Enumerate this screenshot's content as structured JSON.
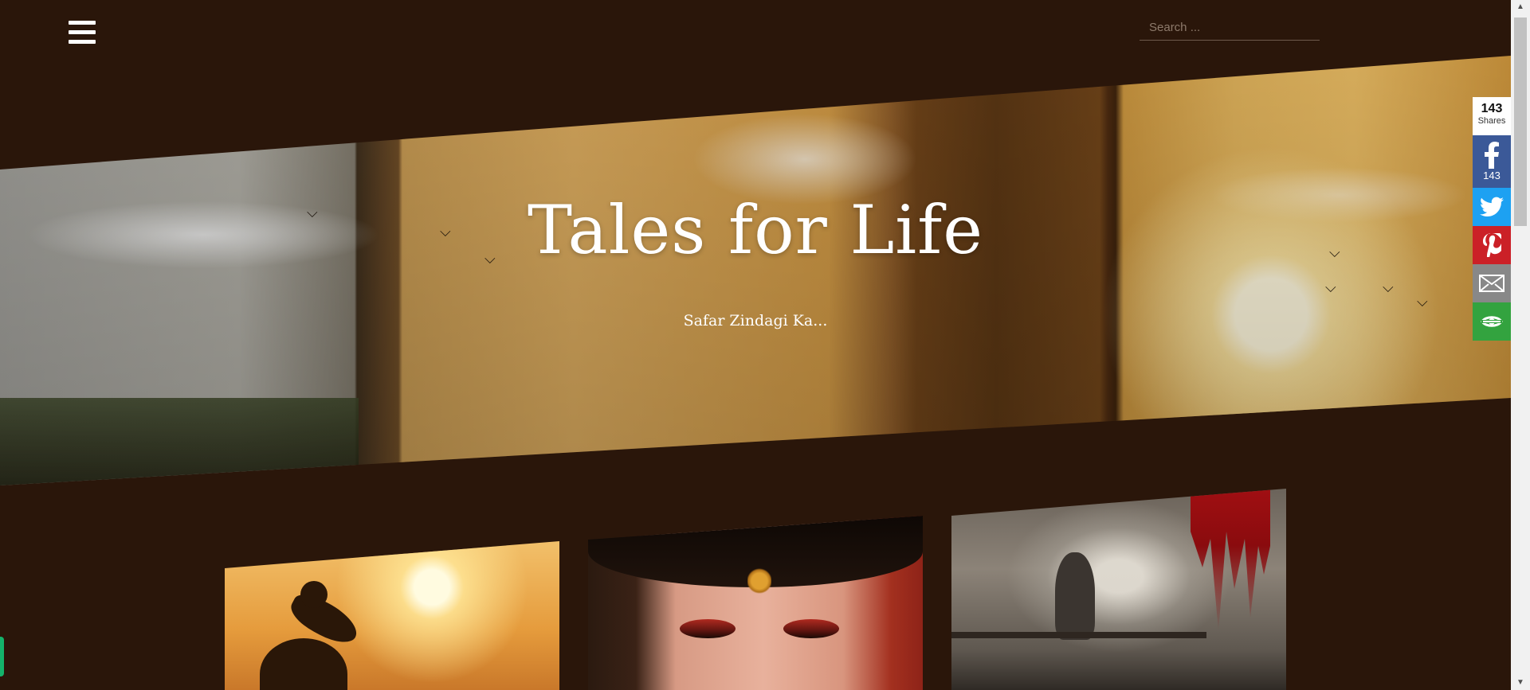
{
  "header": {
    "menu_icon": "hamburger-menu-icon",
    "search": {
      "placeholder": "Search ...",
      "value": ""
    }
  },
  "hero": {
    "title": "Tales for Life",
    "tagline": "Safar Zindagi Ka..."
  },
  "share_bar": {
    "total_count": "143",
    "total_label": "Shares",
    "buttons": [
      {
        "network": "facebook",
        "icon": "facebook-icon",
        "count": "143",
        "color": "#3b5998"
      },
      {
        "network": "twitter",
        "icon": "twitter-icon",
        "color": "#1da1f2"
      },
      {
        "network": "pinterest",
        "icon": "pinterest-icon",
        "color": "#cb2027"
      },
      {
        "network": "email",
        "icon": "email-icon",
        "color": "#888888"
      },
      {
        "network": "more",
        "icon": "more-share-icon",
        "color": "#33a33f"
      }
    ]
  },
  "posts": [
    {
      "thumbnail": "parent-lifting-child-silhouette-at-sunset"
    },
    {
      "thumbnail": "bride-with-maang-tikka"
    },
    {
      "thumbnail": "girl-on-bench-with-skull-and-blood"
    }
  ],
  "colors": {
    "background": "#2a160a",
    "chat_tab": "#14b36b"
  }
}
